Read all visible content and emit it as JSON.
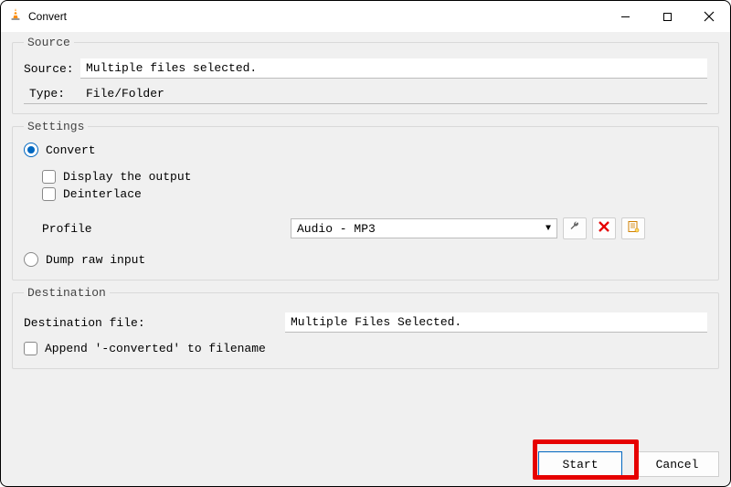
{
  "window": {
    "title": "Convert"
  },
  "source": {
    "legend": "Source",
    "source_label": "Source:",
    "source_value": "Multiple files selected.",
    "type_label": "Type:",
    "type_value": "File/Folder"
  },
  "settings": {
    "legend": "Settings",
    "convert_label": "Convert",
    "display_output_label": "Display the output",
    "deinterlace_label": "Deinterlace",
    "profile_label": "Profile",
    "profile_value": "Audio - MP3",
    "dump_raw_label": "Dump raw input"
  },
  "destination": {
    "legend": "Destination",
    "dest_file_label": "Destination file:",
    "dest_file_value": "Multiple Files Selected.",
    "append_label": "Append '-converted' to filename"
  },
  "footer": {
    "start_label": "Start",
    "cancel_label": "Cancel"
  },
  "icons": {
    "wrench": "wrench-icon",
    "delete": "delete-icon",
    "new_profile": "new-profile-icon",
    "dropdown": "▾"
  }
}
